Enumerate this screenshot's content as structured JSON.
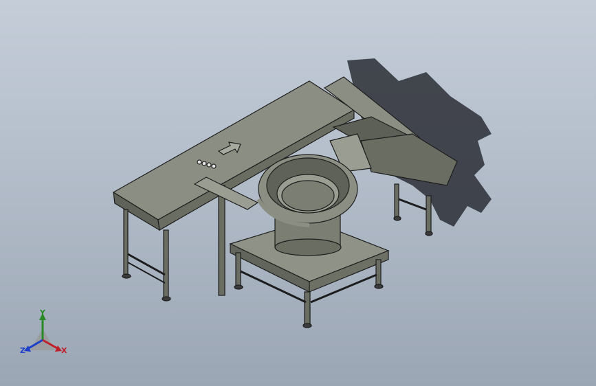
{
  "viewport": {
    "background_top": "#c4cdd8",
    "background_bottom": "#9ba6b4"
  },
  "model": {
    "body_color": "#7c7f72",
    "edge_color": "#1d1d1d",
    "shadow_color": "#2b2e35",
    "arrow_direction": "up-right"
  },
  "triad": {
    "x_label": "X",
    "y_label": "Y",
    "z_label": "Z",
    "x_color": "#c0202a",
    "y_color": "#2a8a2a",
    "z_color": "#1f3ec8"
  }
}
